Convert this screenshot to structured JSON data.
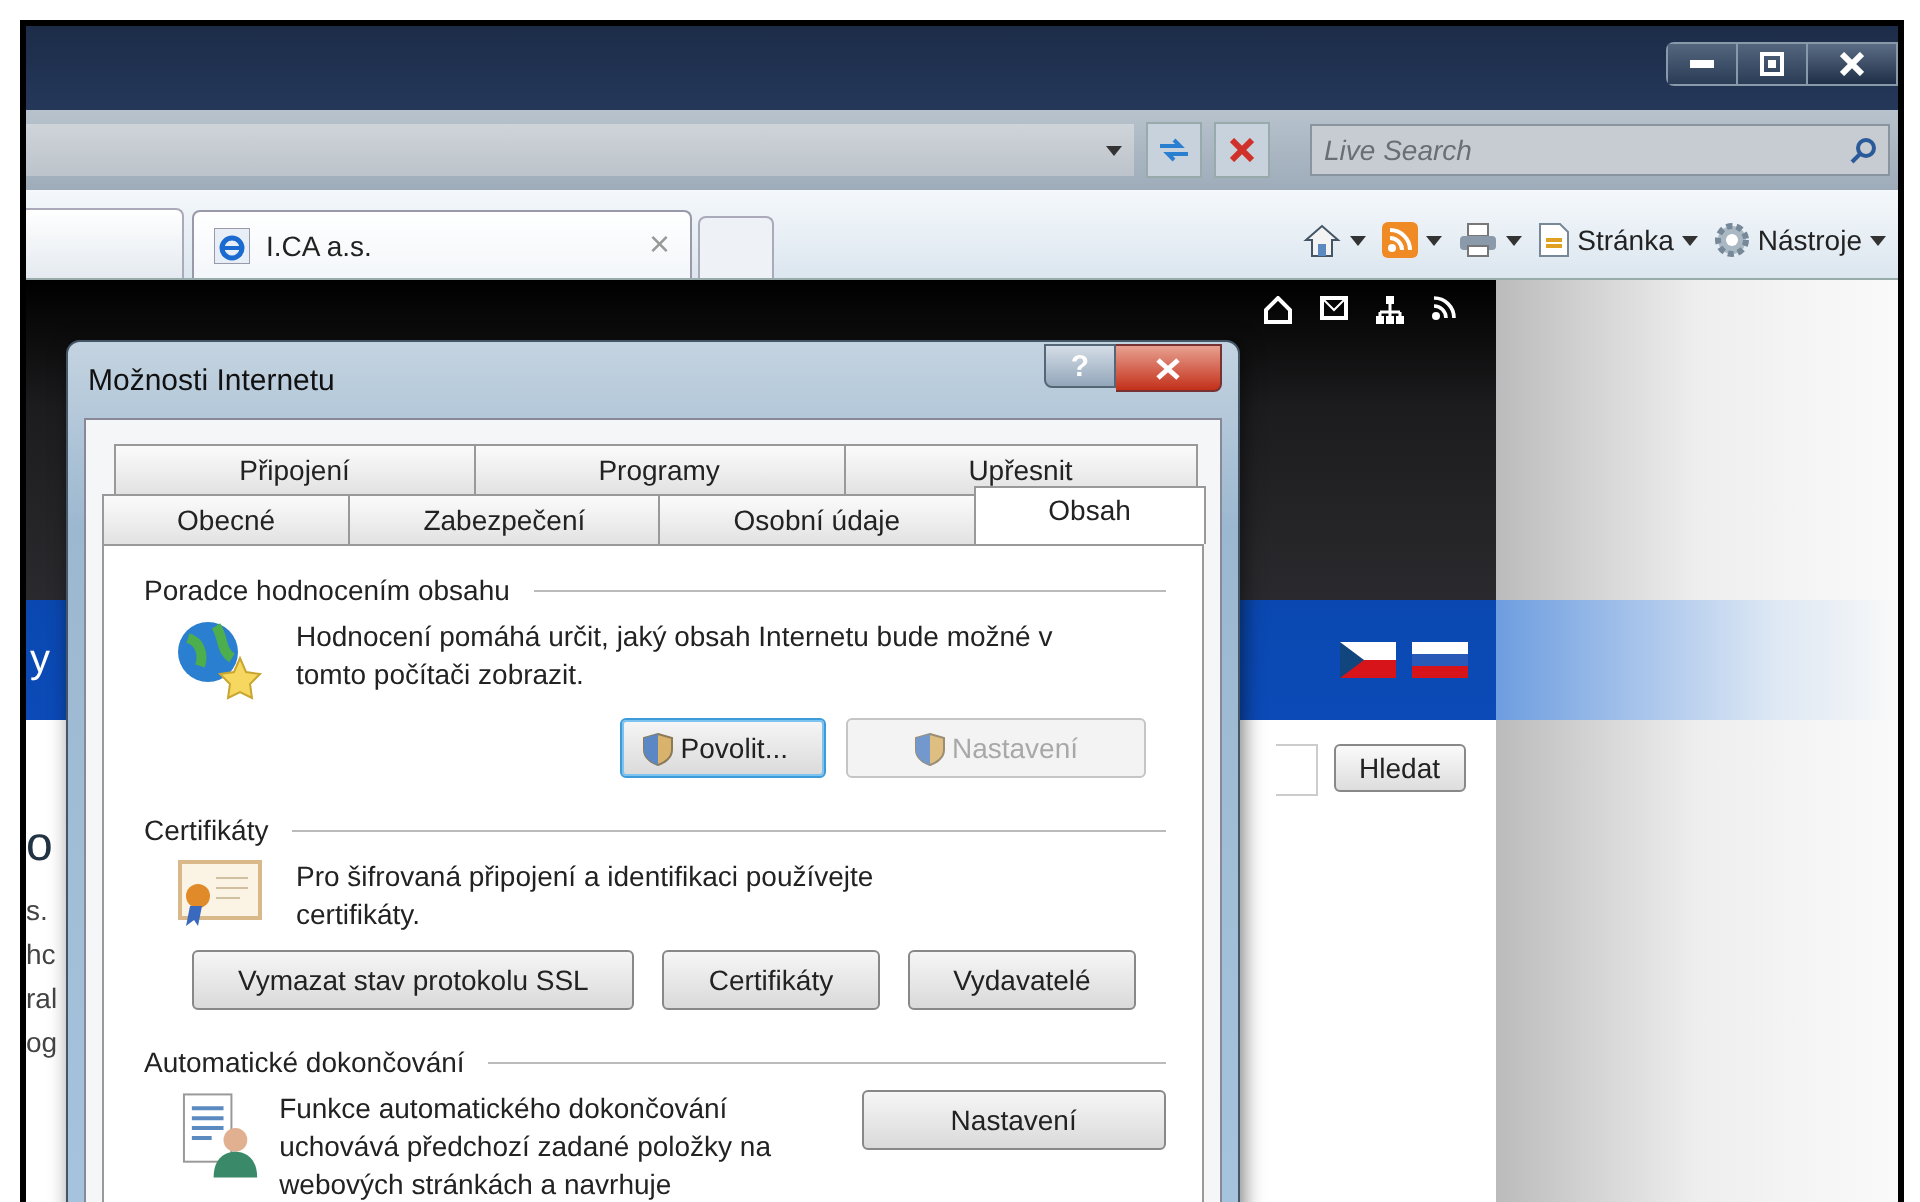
{
  "browser": {
    "search_placeholder": "Live Search",
    "tabs": [
      {
        "label": "I.CA a.s.",
        "selected": true,
        "close": "×"
      }
    ],
    "toolbar": [
      {
        "kind": "home"
      },
      {
        "kind": "feeds"
      },
      {
        "kind": "print"
      },
      {
        "kind": "page",
        "label": "Stránka"
      },
      {
        "kind": "tools",
        "label": "Nástroje"
      }
    ]
  },
  "page": {
    "search_button": "Hledat",
    "edge_fragments": [
      {
        "text": "y",
        "kind": "band"
      },
      {
        "text": "o",
        "kind": "heading"
      },
      {
        "text": "s.",
        "kind": "body"
      },
      {
        "text": "hc",
        "kind": "body"
      },
      {
        "text": "ral",
        "kind": "body"
      },
      {
        "text": "og",
        "kind": "body"
      }
    ]
  },
  "dialog": {
    "title": "Možnosti Internetu",
    "help": "?",
    "tab_rows": [
      [
        {
          "label": "Připojení",
          "selected": false
        },
        {
          "label": "Programy",
          "selected": false
        },
        {
          "label": "Upřesnit",
          "selected": false
        }
      ],
      [
        {
          "label": "Obecné",
          "selected": false
        },
        {
          "label": "Zabezpečení",
          "selected": false
        },
        {
          "label": "Osobní údaje",
          "selected": false
        },
        {
          "label": "Obsah",
          "selected": true
        }
      ]
    ],
    "sections": [
      {
        "kind": "ratings",
        "title": "Poradce hodnocením obsahu",
        "text": "Hodnocení pomáhá určit, jaký obsah Internetu bude možné v tomto počítači zobrazit.",
        "buttons": [
          {
            "label": "Povolit...",
            "shield": true,
            "focused": true,
            "disabled": false
          },
          {
            "label": "Nastavení",
            "shield": true,
            "focused": false,
            "disabled": true
          }
        ]
      },
      {
        "kind": "certificates",
        "title": "Certifikáty",
        "text": "Pro šifrovaná připojení a identifikaci používejte certifikáty.",
        "buttons": [
          {
            "label": "Vymazat stav protokolu SSL",
            "shield": false,
            "focused": false,
            "disabled": false
          },
          {
            "label": "Certifikáty",
            "shield": false,
            "focused": false,
            "disabled": false
          },
          {
            "label": "Vydavatelé",
            "shield": false,
            "focused": false,
            "disabled": false
          }
        ]
      },
      {
        "kind": "autocomplete",
        "title": "Automatické dokončování",
        "text": "Funkce automatického dokončování uchovává předchozí zadané položky na webových stránkách a navrhuje",
        "buttons": [
          {
            "label": "Nastavení",
            "shield": false,
            "focused": false,
            "disabled": false
          }
        ]
      }
    ]
  }
}
